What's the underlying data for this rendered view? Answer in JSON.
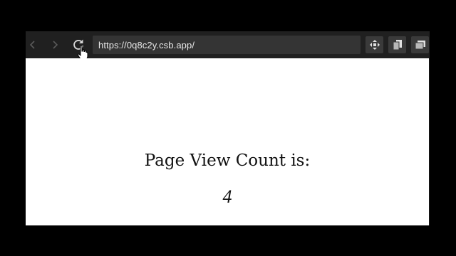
{
  "browser": {
    "url": "https://0q8c2y.csb.app/",
    "icons": {
      "back": "chevron-left-icon",
      "forward": "chevron-right-icon",
      "reload": "reload-icon",
      "tool_1": "move-arrows-icon",
      "tool_2": "copy-pages-icon",
      "tool_3": "window-icon",
      "cursor": "hand-pointer-icon"
    }
  },
  "page": {
    "label": "Page View Count is:",
    "count": "4"
  },
  "colors": {
    "frame": "#000000",
    "toolbar": "#202020",
    "address_bar": "#343434",
    "page_bg": "#ffffff",
    "text": "#111111"
  }
}
